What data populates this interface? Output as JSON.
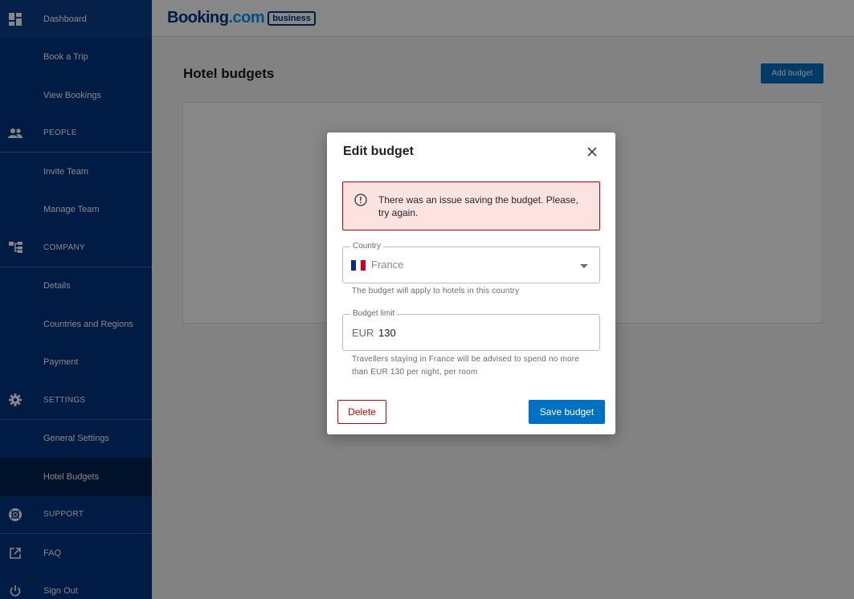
{
  "sidebar": {
    "items": [
      {
        "label": "Dashboard",
        "icon": "dashboard-icon"
      },
      {
        "label": "Book a Trip"
      },
      {
        "label": "View Bookings"
      },
      {
        "label": "PEOPLE",
        "icon": "people-icon"
      },
      {
        "label": "Invite Team"
      },
      {
        "label": "Manage Team"
      },
      {
        "label": "COMPANY",
        "icon": "company-icon"
      },
      {
        "label": "Details"
      },
      {
        "label": "Countries and Regions"
      },
      {
        "label": "Payment"
      },
      {
        "label": "SETTINGS",
        "icon": "gear-icon"
      },
      {
        "label": "General Settings"
      },
      {
        "label": "Hotel Budgets"
      },
      {
        "label": "SUPPORT",
        "icon": "support-icon"
      },
      {
        "label": "FAQ",
        "icon": "external-link-icon"
      },
      {
        "label": "Sign Out",
        "icon": "power-icon"
      }
    ]
  },
  "header": {
    "logo_booking": "Booking",
    "logo_com": ".com",
    "logo_badge": "business"
  },
  "main": {
    "title": "Hotel budgets",
    "add_button": "Add budget"
  },
  "modal": {
    "title": "Edit budget",
    "alert": "There was an issue saving the budget. Please, try again.",
    "country": {
      "label": "Country",
      "value": "France",
      "helper": "The budget will apply to hotels in this country"
    },
    "budget": {
      "label": "Budget limit",
      "currency": "EUR",
      "value": "130",
      "helper": "Travellers staying in France will be advised to spend no more than EUR 130 per night, per room"
    },
    "delete_label": "Delete",
    "save_label": "Save budget"
  },
  "colors": {
    "brand_navy": "#003580",
    "primary_blue": "#0071c2",
    "error_red": "#cc0000",
    "error_bg": "#fde2e2"
  }
}
